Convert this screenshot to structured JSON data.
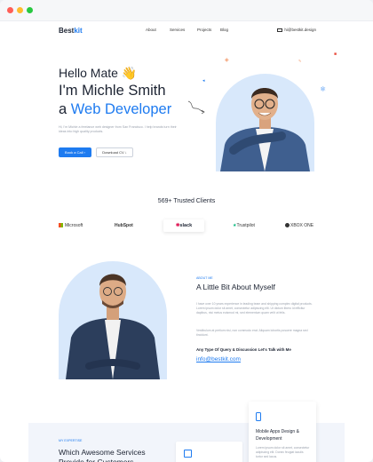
{
  "nav": {
    "logo_a": "Best",
    "logo_b": "kit",
    "items": [
      {
        "label": "About"
      },
      {
        "label": "Services"
      },
      {
        "label": "Projects"
      },
      {
        "label": "Blog"
      }
    ],
    "email": "hi@bestkit.design"
  },
  "hero": {
    "greeting": "Hello Mate",
    "wave": "👋",
    "name_line": "I'm Michle Smith",
    "role_prefix": "a ",
    "role": "Web Developer",
    "description": "Hi, I'm Michle a freelance web designer from San Francisco. I help brands turn their ideas into high quality products.",
    "cta_primary": "Book a Call",
    "cta_secondary": "Download CV"
  },
  "clients": {
    "title": "569+ Trusted Clients",
    "logos": [
      "Microsoft",
      "HubSpot",
      "slack",
      "Trustpilot",
      "XBOX ONE"
    ]
  },
  "about": {
    "tag": "ABOUT ME",
    "title": "A Little Bit About Myself",
    "para1": "I have over 10 years experience in leading team and shipping complex digital products. Lorem ipsum dolor sit amet, consectetur adipiscing elit. Ut dictum libero id efficitur dapibus, nisi metus euismod mi, sed elementum quam velit ut felis.",
    "para2": "Vestibulum at pretium nisi, non commodo erat. Aliquam lobortis posuere magna sed tincidunt.",
    "query": "Any Type Of Query & Discussion Let's Talk with Me",
    "email": "info@bestkit.com"
  },
  "services": {
    "tag": "MY EXPERTISE",
    "title": "Which Awesome Services Provide for Customers",
    "card_title": "Mobile Apps Design & Development",
    "card_desc": "Lorem ipsum dolor sit amet, consectetur adipiscing elit. Donec feugiat iaculis tortor sed lacus."
  },
  "colors": {
    "accent": "#1e7bf0",
    "arch": "#d8e8fb",
    "dark": "#1d2433"
  }
}
